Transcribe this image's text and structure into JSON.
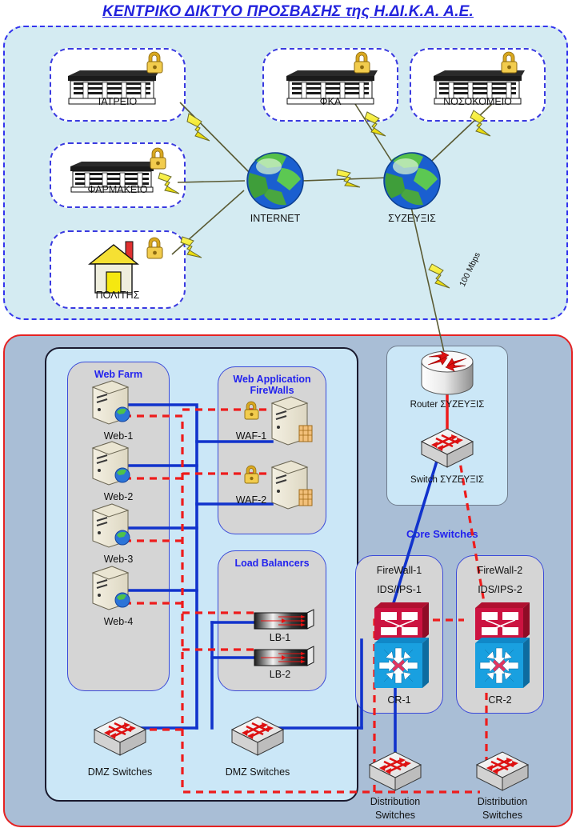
{
  "title": "ΚΕΝΤΡΙΚΟ ΔΙΚΤΥΟ ΠΡΟΣΒΑΣΗΣ της Η.ΔΙ.Κ.Α. Α.Ε.",
  "colors": {
    "title": "#2222dd",
    "access_zone_bg": "#d4ebf2",
    "access_zone_border": "#3333ee",
    "core_zone_bg": "#a9bed6",
    "core_zone_border": "#e52222",
    "dmz_zone_bg": "#cbe7f7",
    "dmz_zone_border": "#1a1a2e",
    "group_bg": "#d5d5d5",
    "group_border": "#3b4ad8",
    "group_title": "#2222ee",
    "blue_link": "#1133cc",
    "red_link": "#ee1c1c",
    "lightning": "#f5ed16"
  },
  "access_zone": {
    "nodes": [
      {
        "id": "iatreio",
        "label": "ΙΑΤΡΕΙΟ",
        "icon": "building-icon",
        "lock": "padlock-icon"
      },
      {
        "id": "farmakeio",
        "label": "ΦΑΡΜΑΚΕΙΟ",
        "icon": "building-icon",
        "lock": "padlock-icon"
      },
      {
        "id": "politis",
        "label": "ΠΟΛΙΤΗΣ",
        "icon": "house-icon",
        "lock": "padlock-icon"
      },
      {
        "id": "fka",
        "label": "ΦΚΑ",
        "icon": "building-icon",
        "lock": "padlock-icon"
      },
      {
        "id": "nosokomeio",
        "label": "ΝΟΣΟΚΟΜΕΙΟ",
        "icon": "building-icon",
        "lock": "padlock-icon"
      }
    ],
    "clouds": [
      {
        "id": "internet",
        "label": "INTERNET",
        "icon": "globe-icon"
      },
      {
        "id": "suzeuxis",
        "label": "ΣΥΖΕΥΞΙΣ",
        "icon": "globe-icon"
      }
    ],
    "link_speed": "100 Mbps"
  },
  "core_zone": {
    "suzeuxis_block": {
      "router": {
        "label": "Router ΣΥΖΕΥΞΙΣ",
        "icon": "router-icon"
      },
      "switch": {
        "label": "Switch ΣΥΖΕΥΞΙΣ",
        "icon": "switch-icon"
      }
    },
    "web_farm": {
      "title": "Web Farm",
      "servers": [
        {
          "label": "Web-1",
          "icon": "web-server-icon"
        },
        {
          "label": "Web-2",
          "icon": "web-server-icon"
        },
        {
          "label": "Web-3",
          "icon": "web-server-icon"
        },
        {
          "label": "Web-4",
          "icon": "web-server-icon"
        }
      ]
    },
    "waf": {
      "title_line1": "Web Application",
      "title_line2": "FireWalls",
      "devices": [
        {
          "label": "WAF-1",
          "icon": "firewall-server-icon",
          "lock": "padlock-icon"
        },
        {
          "label": "WAF-2",
          "icon": "firewall-server-icon",
          "lock": "padlock-icon"
        }
      ]
    },
    "load_balancers": {
      "title": "Load Balancers",
      "devices": [
        {
          "label": "LB-1",
          "icon": "load-balancer-icon"
        },
        {
          "label": "LB-2",
          "icon": "load-balancer-icon"
        }
      ]
    },
    "core_switches": {
      "title": "Core Switches",
      "stacks": [
        {
          "firewall": "FireWall-1",
          "ids": "IDS/IPS-1",
          "core": "CR-1",
          "icon": "firewall-core-icon"
        },
        {
          "firewall": "FireWall-2",
          "ids": "IDS/IPS-2",
          "core": "CR-2",
          "icon": "firewall-core-icon"
        }
      ]
    },
    "dmz_switches": [
      {
        "label": "DMZ Switches",
        "icon": "switch-icon"
      },
      {
        "label": "DMZ Switches",
        "icon": "switch-icon"
      }
    ],
    "distribution_switches": [
      {
        "line1": "Distribution",
        "line2": "Switches",
        "icon": "switch-icon"
      },
      {
        "line1": "Distribution",
        "line2": "Switches",
        "icon": "switch-icon"
      }
    ]
  }
}
